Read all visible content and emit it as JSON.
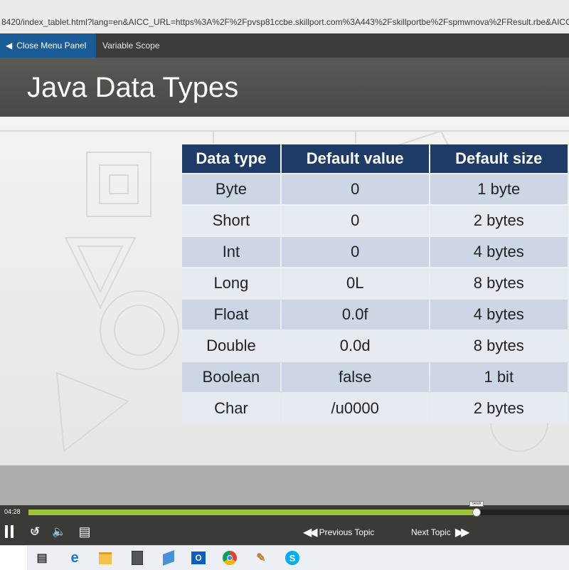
{
  "browser": {
    "url": "8420/index_tablet.html?lang=en&AICC_URL=https%3A%2F%2Fpvsp81ccbe.skillport.com%3A443%2Fskillportbe%2Fspmwnova%2FResult.rbe&AICC"
  },
  "topnav": {
    "close_menu_label": "Close Menu Panel",
    "current_topic": "Variable Scope"
  },
  "slide": {
    "title": "Java Data Types",
    "table": {
      "headers": [
        "Data type",
        "Default value",
        "Default size"
      ],
      "rows": [
        [
          "Byte",
          "0",
          "1 byte"
        ],
        [
          "Short",
          "0",
          "2 bytes"
        ],
        [
          "Int",
          "0",
          "4 bytes"
        ],
        [
          "Long",
          "0L",
          "8 bytes"
        ],
        [
          "Float",
          "0.0f",
          "4 bytes"
        ],
        [
          "Double",
          "0.0d",
          "8 bytes"
        ],
        [
          "Boolean",
          "false",
          "1 bit"
        ],
        [
          "Char",
          "/u0000",
          "2 bytes"
        ]
      ]
    }
  },
  "player": {
    "elapsed": "04:28",
    "seek_tooltip": "Seek",
    "progress_fraction": 0.8289,
    "replay_seconds": "30",
    "previous_label": "Previous Topic",
    "next_label": "Next Topic",
    "accent_color": "#9ec53a"
  },
  "taskbar": {
    "icons": [
      "task-view-icon",
      "edge-icon",
      "file-explorer-icon",
      "calculator-icon",
      "app-icon",
      "outlook-icon",
      "chrome-icon",
      "paint-icon",
      "skype-icon"
    ]
  }
}
